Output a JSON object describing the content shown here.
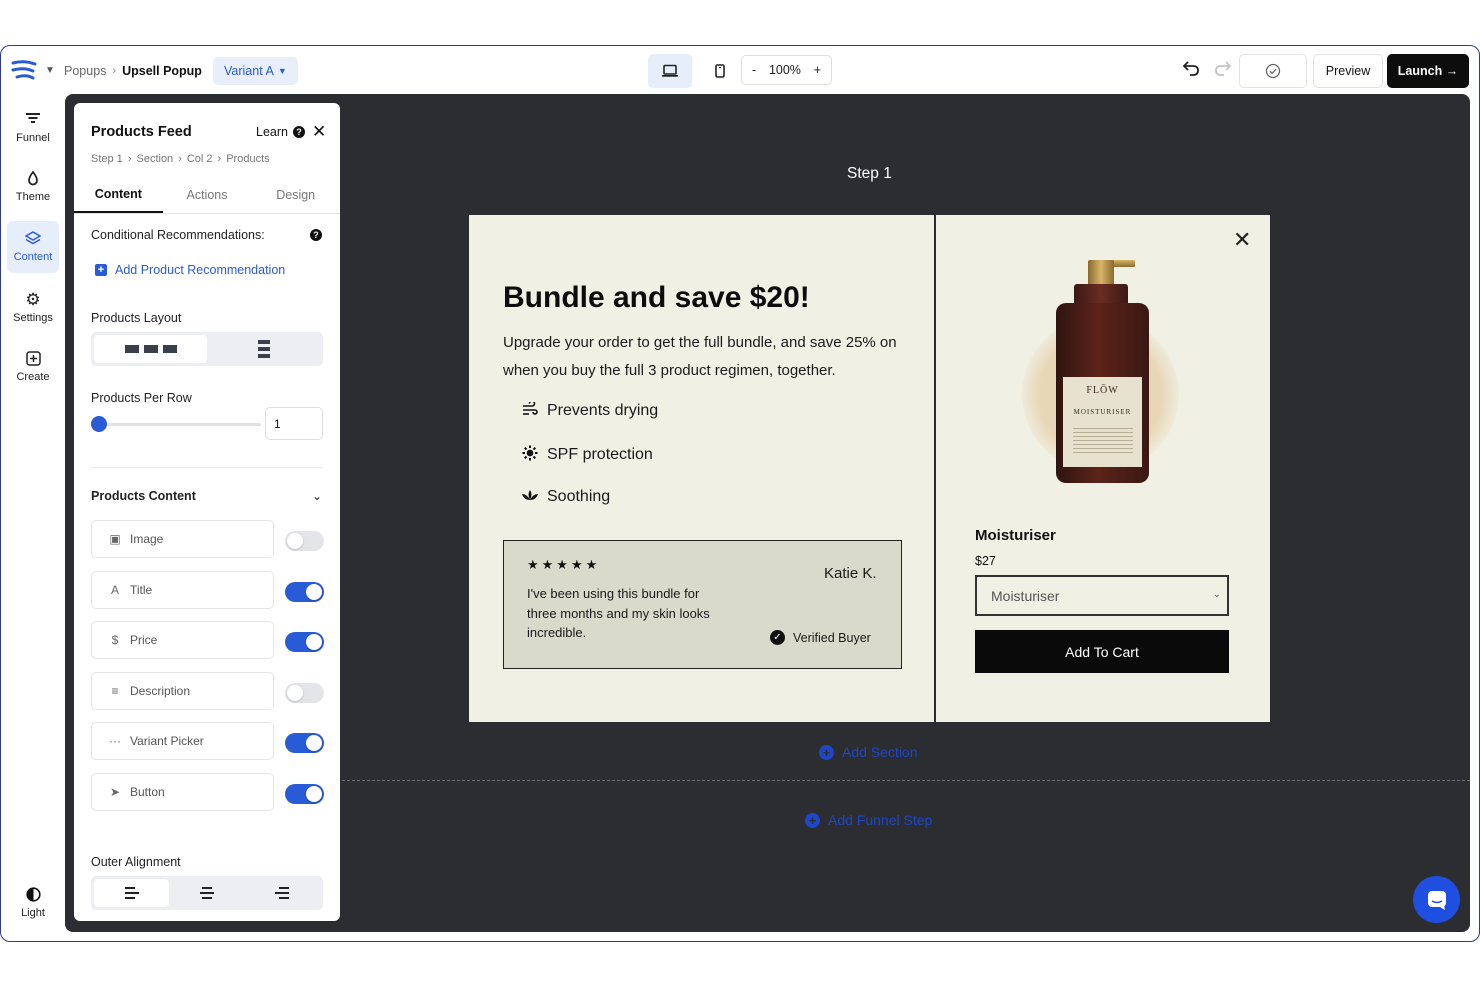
{
  "breadcrumb": {
    "root": "Popups",
    "current": "Upsell Popup",
    "variant": "Variant A"
  },
  "toolbar": {
    "zoom": "100%",
    "zoom_minus": "-",
    "zoom_plus": "+",
    "preview": "Preview",
    "launch": "Launch →"
  },
  "rail": {
    "items": [
      {
        "label": "Funnel",
        "icon": "funnel-icon"
      },
      {
        "label": "Theme",
        "icon": "droplet-icon"
      },
      {
        "label": "Content",
        "icon": "layers-icon",
        "active": true
      },
      {
        "label": "Settings",
        "icon": "gear-icon"
      },
      {
        "label": "Create",
        "icon": "plus-square-icon"
      }
    ],
    "bottom": {
      "label": "Light",
      "icon": "contrast-icon"
    }
  },
  "panel": {
    "title": "Products Feed",
    "learn": "Learn",
    "crumbs": [
      "Step 1",
      "Section",
      "Col 2",
      "Products"
    ],
    "tabs": [
      "Content",
      "Actions",
      "Design"
    ],
    "conditional_label": "Conditional Recommendations:",
    "add_recommendation": "Add Product Recommendation",
    "layout_label": "Products Layout",
    "per_row_label": "Products Per Row",
    "per_row_value": "1",
    "per_row_fraction": 0,
    "content_label": "Products Content",
    "toggles": [
      {
        "label": "Image",
        "icon": "image-icon",
        "on": false
      },
      {
        "label": "Title",
        "icon": "text-icon",
        "on": true
      },
      {
        "label": "Price",
        "icon": "dollar-icon",
        "on": true
      },
      {
        "label": "Description",
        "icon": "align-icon",
        "on": false
      },
      {
        "label": "Variant Picker",
        "icon": "dots-icon",
        "on": true
      },
      {
        "label": "Button",
        "icon": "cursor-icon",
        "on": true
      }
    ],
    "outer_alignment_label": "Outer Alignment"
  },
  "canvas": {
    "step_label": "Step 1",
    "add_section": "Add Section",
    "add_funnel_step": "Add Funnel Step"
  },
  "popup": {
    "title": "Bundle and save $20!",
    "subtitle": "Upgrade your order to get the full bundle, and save 25% on when you buy the full 3 product regimen, together.",
    "features": [
      {
        "label": "Prevents drying",
        "icon": "wind-icon"
      },
      {
        "label": "SPF protection",
        "icon": "sun-icon"
      },
      {
        "label": "Soothing",
        "icon": "lotus-icon"
      }
    ],
    "review": {
      "stars": "★★★★★",
      "text": "I've been using this bundle for three months and my skin looks incredible.",
      "name": "Katie K.",
      "verified": "Verified Buyer"
    },
    "product": {
      "brand": "FLŌW",
      "label_name": "MOISTURISER",
      "name": "Moisturiser",
      "price": "$27",
      "select_value": "Moisturiser",
      "button": "Add To Cart"
    }
  },
  "colors": {
    "accent": "#2a5bd7",
    "canvas": "#2b2d30",
    "popup_bg": "#f1f0e5",
    "cta": "#0a0a0a"
  }
}
